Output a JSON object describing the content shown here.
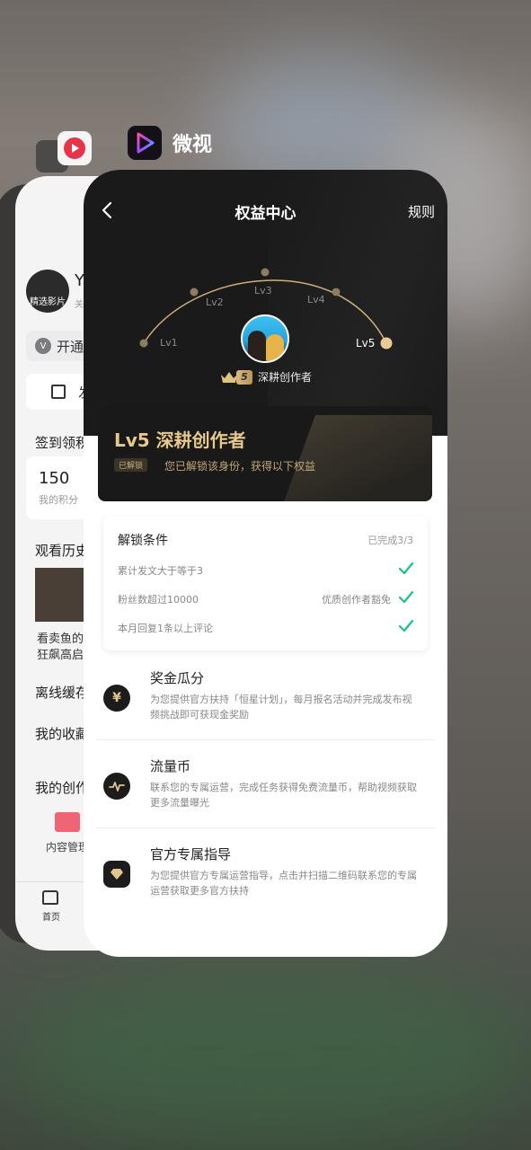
{
  "switcher": {
    "front_app_name": "微视"
  },
  "back_card": {
    "profile_initial": "Y",
    "avatar_caption": "精选影片",
    "follow_prefix": "关",
    "open_vip": "开通",
    "post": "发",
    "sign_title": "签到领积",
    "points_value": "150",
    "points_label": "我的积分",
    "history_title": "观看历史",
    "history_line1": "看卖鱼的",
    "history_line2": "狂飙高启",
    "cache_title": "离线缓存",
    "favorites_title": "我的收藏",
    "creator_title": "我的创作",
    "content_manage": "内容管理",
    "nav_home": "首页"
  },
  "header": {
    "title": "权益中心",
    "rules": "规则"
  },
  "levels": {
    "labels": [
      "Lv1",
      "Lv2",
      "Lv3",
      "Lv4",
      "Lv5"
    ],
    "current_index": 4,
    "current_level_number": "5",
    "badge_name": "深耕创作者"
  },
  "level_card": {
    "title": "Lv5 深耕创作者",
    "tag": "已解锁",
    "subtitle": "您已解锁该身份，获得以下权益"
  },
  "unlock": {
    "title": "解锁条件",
    "progress": "已完成3/3",
    "conditions": [
      {
        "label": "累计发文大于等于3",
        "note": ""
      },
      {
        "label": "粉丝数超过10000",
        "note": "优质创作者豁免"
      },
      {
        "label": "本月回复1条以上评论",
        "note": ""
      }
    ]
  },
  "benefits": [
    {
      "icon": "yen-icon",
      "title": "奖金瓜分",
      "desc": "为您提供官方扶持「恒星计划」，每月报名活动并完成发布视频挑战即可获现金奖励"
    },
    {
      "icon": "traffic-icon",
      "title": "流量币",
      "desc": "联系您的专属运营，完成任务获得免费流量币，帮助视频获取更多流量曝光"
    },
    {
      "icon": "diamond-icon",
      "title": "官方专属指导",
      "desc": "为您提供官方专属运营指导，点击并扫描二维码联系您的专属运营获取更多官方扶持"
    }
  ],
  "colors": {
    "gold": "#e8c98a",
    "check_green": "#19c08a",
    "hero_bg": "#1a1a1a"
  }
}
